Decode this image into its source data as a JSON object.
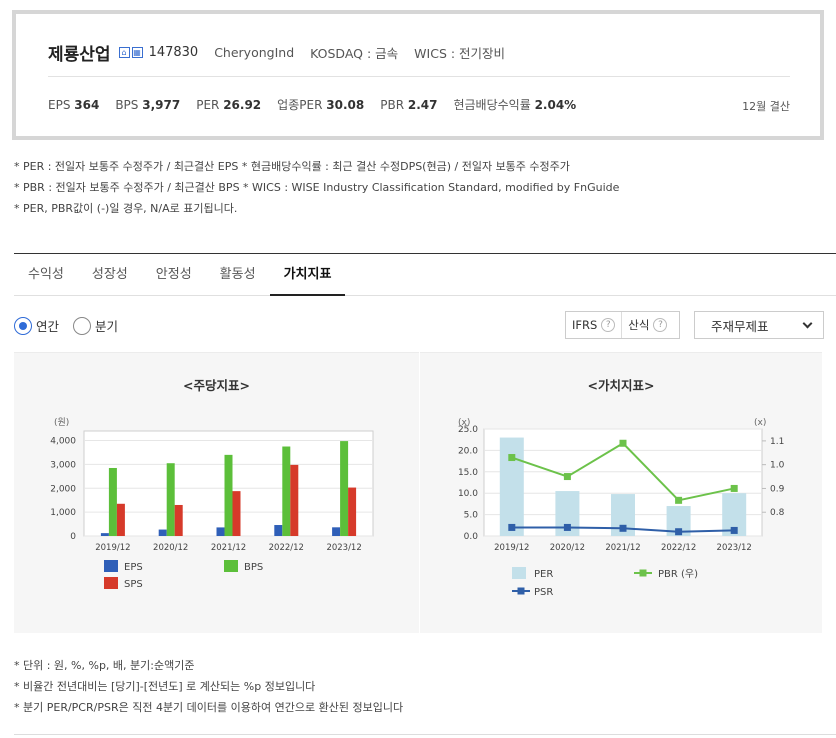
{
  "company": {
    "name": "제룡산업",
    "code": "147830",
    "english_name": "CheryongInd",
    "market": "KOSDAQ : 금속",
    "wics": "WICS : 전기장비"
  },
  "metrics": [
    {
      "label": "EPS",
      "value": "364"
    },
    {
      "label": "BPS",
      "value": "3,977"
    },
    {
      "label": "PER",
      "value": "26.92"
    },
    {
      "label": "업종PER",
      "value": "30.08"
    },
    {
      "label": "PBR",
      "value": "2.47"
    },
    {
      "label": "현금배당수익률",
      "value": "2.04%"
    }
  ],
  "fiscal": "12월 결산",
  "notes_top": [
    "* PER : 전일자 보통주 수정주가 / 최근결산 EPS * 현금배당수익률 : 최근 결산 수정DPS(현금) / 전일자 보통주 수정주가",
    "* PBR : 전일자 보통주 수정주가 / 최근결산 BPS * WICS : WISE Industry Classification Standard, modified by FnGuide",
    "* PER, PBR값이 (-)일 경우, N/A로 표기됩니다."
  ],
  "tabs": [
    "수익성",
    "성장성",
    "안정성",
    "활동성",
    "가치지표"
  ],
  "active_tab": 4,
  "period": {
    "annual": "연간",
    "quarter": "분기"
  },
  "options": {
    "ifrs": "IFRS",
    "calc": "산식",
    "q": "?"
  },
  "statement_select": "주재무제표",
  "colors": {
    "eps": "#2f5fb8",
    "bps": "#5cbf3a",
    "sps": "#d63a2a",
    "per": "#c3e0ea",
    "pbr": "#6cc24a",
    "psr": "#2f5fa8",
    "accent": "#2f6bd7"
  },
  "chart_data": [
    {
      "type": "bar",
      "title": "<주당지표>",
      "ylabel": "(원)",
      "categories": [
        "2019/12",
        "2020/12",
        "2021/12",
        "2022/12",
        "2023/12"
      ],
      "ylim": [
        0,
        4400
      ],
      "yticks": [
        "0",
        "1,000",
        "2,000",
        "3,000",
        "4,000"
      ],
      "ytick_values": [
        0,
        1000,
        2000,
        3000,
        4000
      ],
      "series": [
        {
          "name": "EPS",
          "values": [
            120,
            270,
            360,
            460,
            364
          ]
        },
        {
          "name": "BPS",
          "values": [
            2850,
            3050,
            3400,
            3750,
            3977
          ]
        },
        {
          "name": "SPS",
          "values": [
            1350,
            1300,
            1880,
            2980,
            2030
          ]
        }
      ],
      "legend": "bottom"
    },
    {
      "type": "bar+line",
      "title": "<가치지표>",
      "ylabel_left": "(x)",
      "ylabel_right": "(x)",
      "categories": [
        "2019/12",
        "2020/12",
        "2021/12",
        "2022/12",
        "2023/12"
      ],
      "ylim_left": [
        0,
        25
      ],
      "yticks_left": [
        "0.0",
        "5.0",
        "10.0",
        "15.0",
        "20.0",
        "25.0"
      ],
      "ytick_values_left": [
        0,
        5,
        10,
        15,
        20,
        25
      ],
      "ylim_right": [
        0.7,
        1.15
      ],
      "yticks_right": [
        "0.8",
        "0.9",
        "1.0",
        "1.1"
      ],
      "ytick_values_right": [
        0.8,
        0.9,
        1.0,
        1.1
      ],
      "series": [
        {
          "name": "PER",
          "kind": "bar",
          "axis": "left",
          "values": [
            23.0,
            10.5,
            9.8,
            7.0,
            10.0
          ]
        },
        {
          "name": "PBR (우)",
          "kind": "line",
          "axis": "right",
          "values": [
            1.03,
            0.95,
            1.09,
            0.85,
            0.9
          ]
        },
        {
          "name": "PSR",
          "kind": "line",
          "axis": "left",
          "values": [
            2.0,
            2.0,
            1.8,
            1.0,
            1.3
          ]
        }
      ],
      "legend": "bottom"
    }
  ],
  "notes_bottom": [
    "* 단위 : 원, %, %p, 배, 분기:순액기준",
    "* 비율간 전년대비는 [당기]-[전년도] 로 계산되는 %p 정보입니다",
    "* 분기 PER/PCR/PSR은 직전 4분기 데이터를 이용하여 연간으로 환산된 정보입니다"
  ]
}
